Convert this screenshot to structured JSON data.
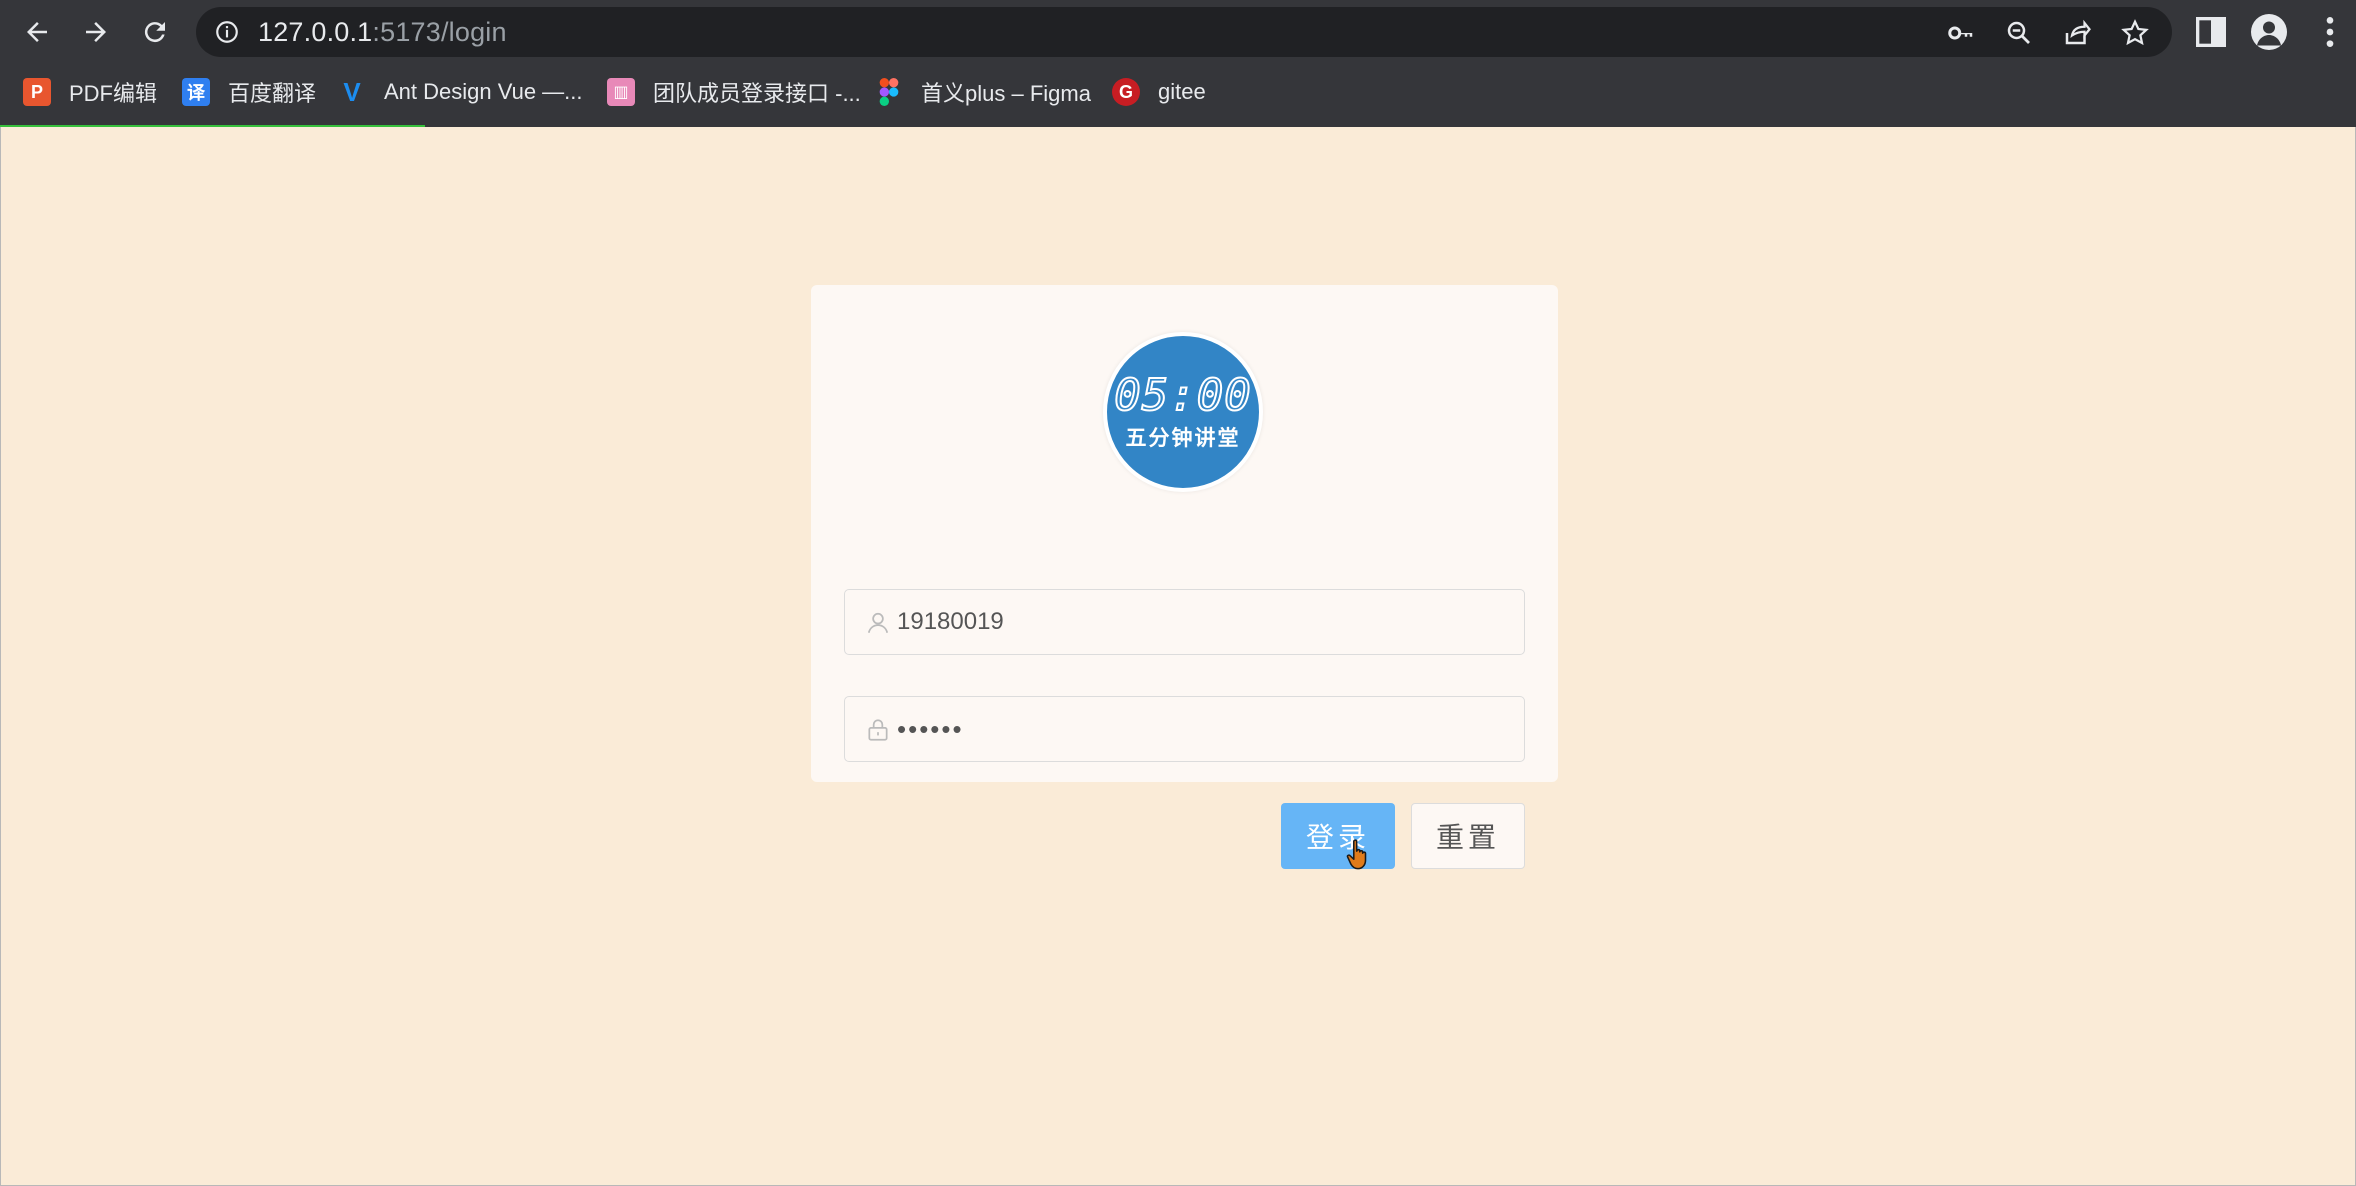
{
  "browser": {
    "url_host": "127.0.0.1",
    "url_path": ":5173/login",
    "bookmarks": [
      {
        "label": "PDF编辑",
        "icon": "pdf-editor-icon",
        "color": "#e8562f",
        "glyph": "P"
      },
      {
        "label": "百度翻译",
        "icon": "baidu-translate-icon",
        "color": "#2f7ff0",
        "glyph": "译"
      },
      {
        "label": "Ant Design Vue —...",
        "icon": "ant-design-vue-icon",
        "color": "#1c8df0",
        "glyph": "V"
      },
      {
        "label": "团队成员登录接口 -...",
        "icon": "api-doc-icon",
        "color": "#e889b8",
        "glyph": "▥"
      },
      {
        "label": "首义plus – Figma",
        "icon": "figma-icon",
        "color": "#a259ff",
        "glyph": "F"
      },
      {
        "label": "gitee",
        "icon": "gitee-icon",
        "color": "#c71d23",
        "glyph": "G"
      }
    ]
  },
  "logo": {
    "time": "05:00",
    "brand": "五分钟讲堂"
  },
  "form": {
    "username": "19180019",
    "password": "••••••",
    "login_label": "登录",
    "reset_label": "重置"
  },
  "colors": {
    "page_bg": "#faebd7",
    "primary": "#66b5f6",
    "logo_bg": "#3285c6"
  }
}
